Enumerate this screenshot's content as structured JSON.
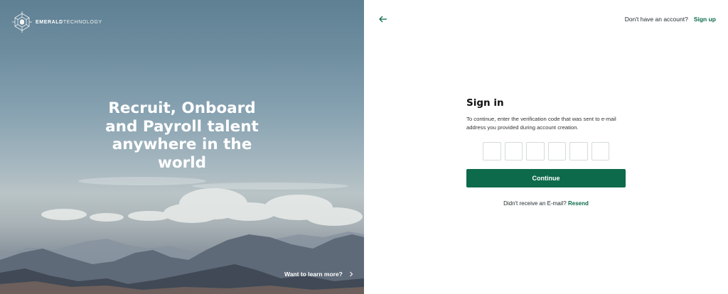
{
  "brand": {
    "name_bold": "EMERALD",
    "name_light": "TECHNOLOGY",
    "logo_icon": "hexagon-logo-icon"
  },
  "hero": {
    "headline": "Recruit, Onboard and Payroll talent anywhere in the world",
    "learn_more": "Want to learn more?",
    "learn_more_icon": "chevron-right-icon"
  },
  "header": {
    "back_icon": "arrow-left-icon",
    "no_account_text": "Don't have an account?",
    "signup_link": "Sign up"
  },
  "form": {
    "title": "Sign in",
    "description": "To continue, enter the verification code that was sent to e-mail address you provided during account creation.",
    "code_digits": [
      "",
      "",
      "",
      "",
      "",
      ""
    ],
    "continue_label": "Continue",
    "resend_prompt": "Didn't receive an E-mail?",
    "resend_link": "Resend"
  },
  "colors": {
    "accent": "#0d6a4b",
    "link": "#0c6b4c",
    "text": "#1f2a2c"
  }
}
